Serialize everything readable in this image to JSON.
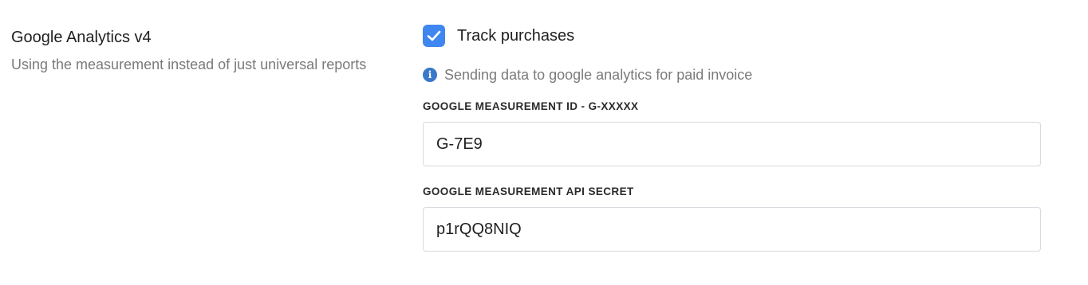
{
  "section": {
    "title": "Google Analytics v4",
    "description": "Using the measurement instead of just universal reports"
  },
  "track_purchases": {
    "label": "Track purchases",
    "checked": true
  },
  "hint": {
    "icon": "info-icon",
    "text": "Sending data to google analytics for paid invoice"
  },
  "fields": {
    "measurement_id": {
      "label": "GOOGLE MEASUREMENT ID - G-XXXXX",
      "value": "G-7E9"
    },
    "api_secret": {
      "label": "GOOGLE MEASUREMENT API SECRET",
      "value": "p1rQQ8NIQ"
    }
  },
  "colors": {
    "accent": "#3f86f0",
    "info": "#3a78c9",
    "muted_text": "#7a7a7a",
    "border": "#d6d9dd"
  }
}
